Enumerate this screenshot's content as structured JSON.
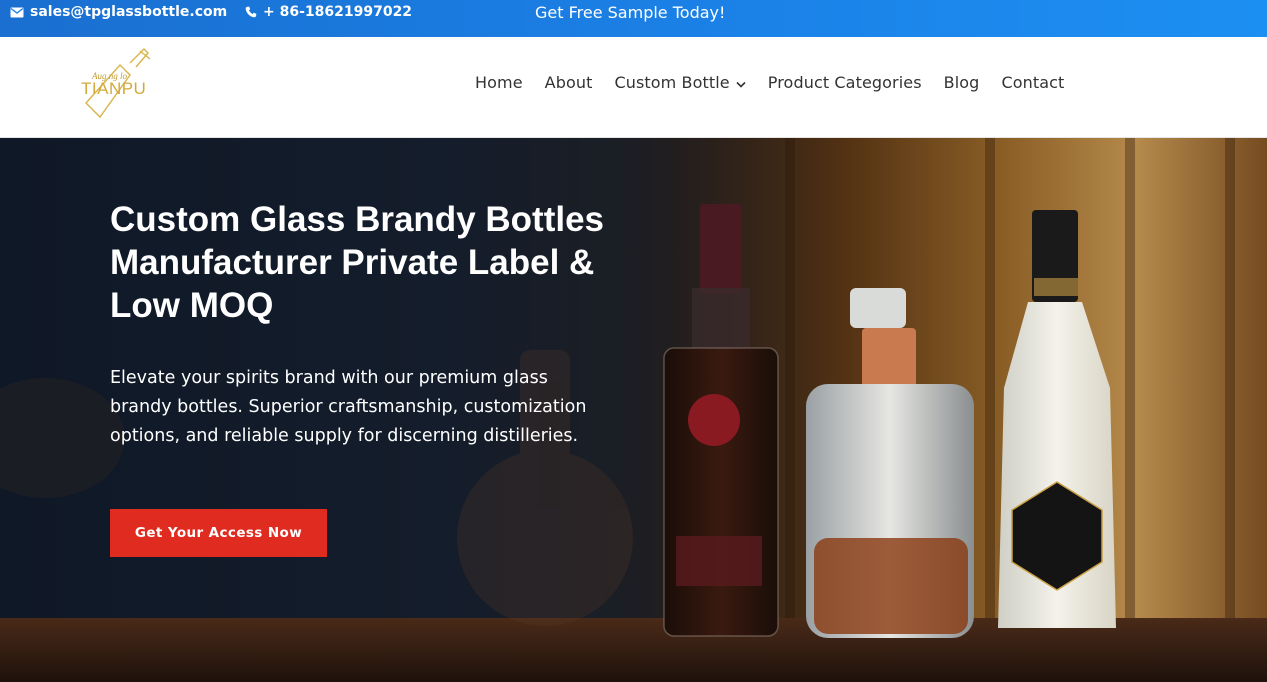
{
  "topbar": {
    "email": "sales@tpglassbottle.com",
    "phone": "+ 86-18621997022",
    "promo": "Get Free Sample Today!",
    "bg_color": "#1b82e8"
  },
  "header": {
    "logo_text": "TIANPU",
    "nav": {
      "home": "Home",
      "about": "About",
      "custom_bottle": "Custom Bottle",
      "product_categories": "Product Categories",
      "blog": "Blog",
      "contact": "Contact"
    }
  },
  "hero": {
    "title": "Custom Glass Brandy Bottles Manufacturer Private Label & Low MOQ",
    "subtitle": "Elevate your spirits brand with our premium glass brandy bottles. Superior craftsmanship, customization options, and reliable supply for discerning distilleries.",
    "cta_label": "Get Your Access Now",
    "cta_color": "#e02b20"
  }
}
